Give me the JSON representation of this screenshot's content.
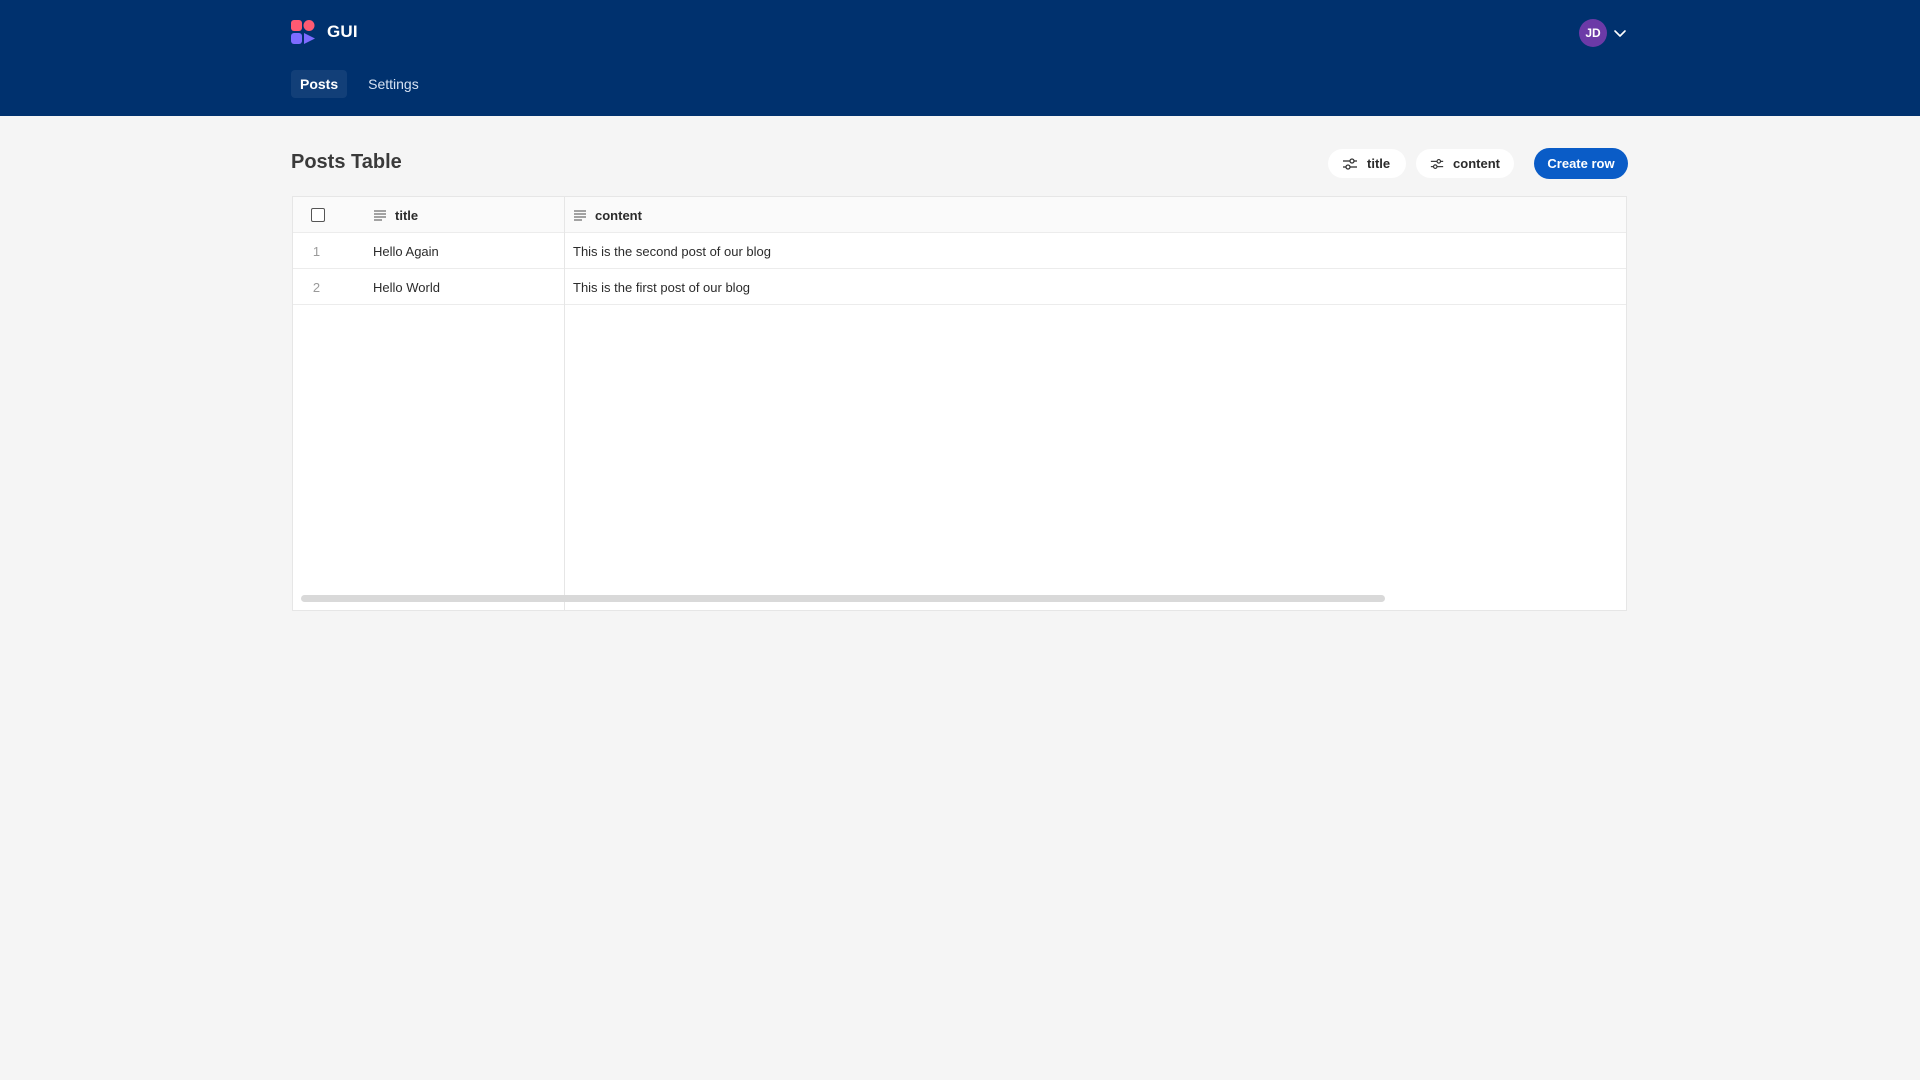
{
  "header": {
    "app_title": "GUI",
    "logo_icon": "app-logo-icon",
    "nav": [
      {
        "label": "Posts",
        "active": true
      },
      {
        "label": "Settings",
        "active": false
      }
    ],
    "user": {
      "initials": "JD",
      "menu_icon": "chevron-down-icon"
    },
    "colors": {
      "background": "#00316e",
      "avatar": "#6c3aa7"
    }
  },
  "toolbar": {
    "page_title": "Posts Table",
    "filters": [
      {
        "label": "title",
        "icon": "sliders-icon"
      },
      {
        "label": "content",
        "icon": "sliders-icon"
      }
    ],
    "create_label": "Create row",
    "accent": "#0a5cc7"
  },
  "table": {
    "columns": [
      {
        "label": "title",
        "icon": "text-lines-icon"
      },
      {
        "label": "content",
        "icon": "text-lines-icon"
      }
    ],
    "rows": [
      {
        "index": "1",
        "title": "Hello Again",
        "content": "This is the second post of our blog"
      },
      {
        "index": "2",
        "title": "Hello World",
        "content": "This is the first post of our blog"
      }
    ]
  }
}
